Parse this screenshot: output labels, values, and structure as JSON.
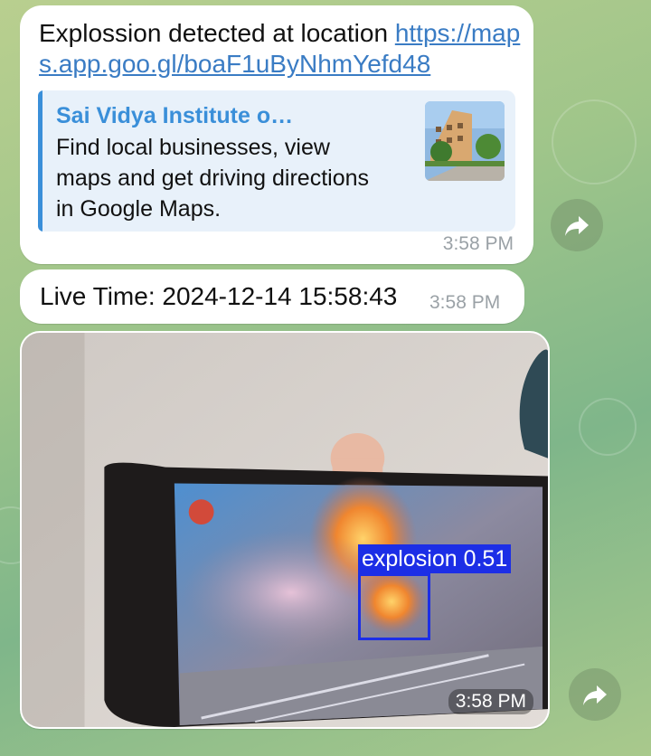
{
  "messages": {
    "location": {
      "text_prefix": "Explossion detected at location ",
      "link": "https://maps.app.goo.gl/boaF1uByNhmYefd48",
      "preview": {
        "title": "Sai Vidya Institute o…",
        "description": "Find local businesses, view maps and get driving directions in Google Maps."
      },
      "time": "3:58 PM"
    },
    "live_time": {
      "text": "Live Time: 2024-12-14 15:58:43",
      "time": "3:58 PM"
    },
    "photo": {
      "detection_label": "explosion 0.51",
      "time": "3:58 PM"
    }
  },
  "icons": {
    "forward": "forward-arrow-icon"
  },
  "colors": {
    "link": "#3a7cc4",
    "preview_accent": "#3a8fd9",
    "detection_box": "#1c2ee6"
  }
}
